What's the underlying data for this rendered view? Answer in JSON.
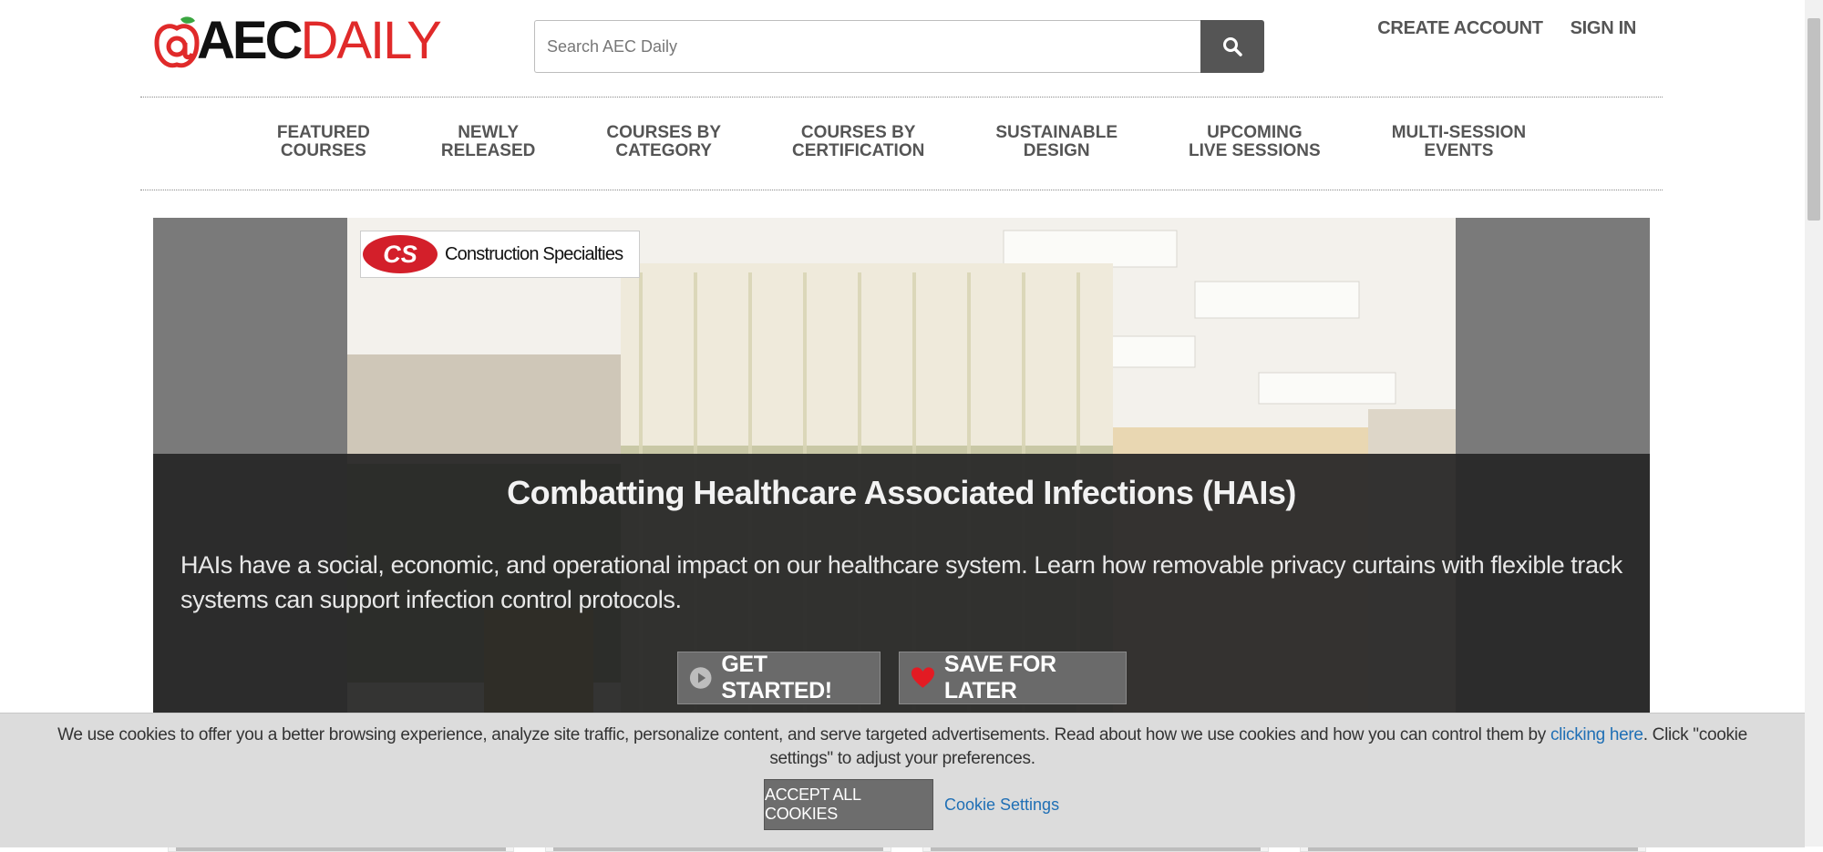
{
  "header": {
    "logo": {
      "at": "@",
      "aec": "AEC",
      "daily": "DAILY"
    },
    "search": {
      "placeholder": "Search AEC Daily"
    },
    "create_account": "CREATE ACCOUNT",
    "sign_in": "SIGN IN"
  },
  "nav": {
    "items": [
      {
        "label": "FEATURED\nCOURSES"
      },
      {
        "label": "NEWLY\nRELEASED"
      },
      {
        "label": "COURSES BY\nCATEGORY"
      },
      {
        "label": "COURSES BY\nCERTIFICATION"
      },
      {
        "label": "SUSTAINABLE\nDESIGN"
      },
      {
        "label": "UPCOMING\nLIVE SESSIONS"
      },
      {
        "label": "MULTI-SESSION\nEVENTS"
      }
    ]
  },
  "hero": {
    "sponsor": {
      "mark": "CS",
      "name": "Construction Specialties"
    },
    "title": "Combatting Healthcare Associated Infections (HAIs)",
    "description": "HAIs have a social, economic, and operational impact on our healthcare system. Learn how removable privacy curtains with flexible track systems can support infection control protocols.",
    "get_started": "GET STARTED!",
    "save_for_later": "SAVE FOR LATER"
  },
  "cookie": {
    "text_before": "We use cookies to offer you a better browsing experience, analyze site traffic, personalize content, and serve targeted advertisements. Read about how we use cookies and how you can control them by ",
    "link": "clicking here",
    "text_after": ". Click \"cookie settings\" to adjust your preferences.",
    "accept": "ACCEPT ALL COOKIES",
    "settings": "Cookie Settings"
  },
  "colors": {
    "brand_red": "#e02a2a",
    "link_blue": "#1f6fb5",
    "hero_overlay": "#262626"
  }
}
